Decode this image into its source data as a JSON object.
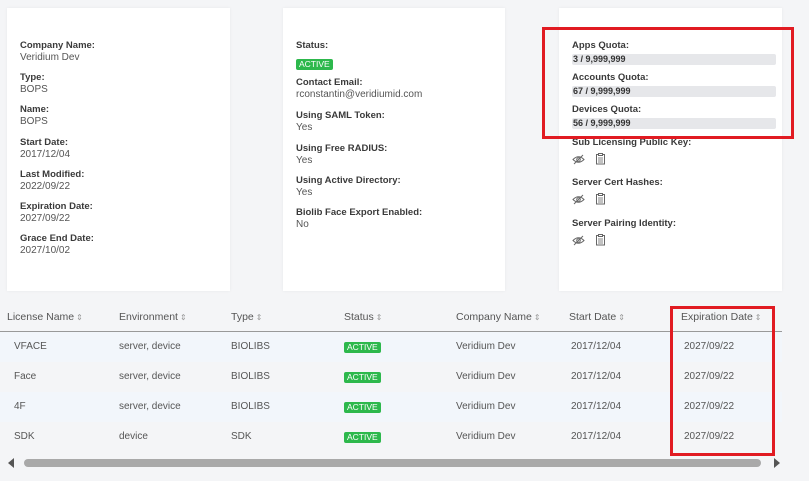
{
  "card1": {
    "fields": [
      {
        "label": "Company Name:",
        "value": "Veridium Dev"
      },
      {
        "label": "Type:",
        "value": "BOPS"
      },
      {
        "label": "Name:",
        "value": "BOPS"
      },
      {
        "label": "Start Date:",
        "value": "2017/12/04"
      },
      {
        "label": "Last Modified:",
        "value": "2022/09/22"
      },
      {
        "label": "Expiration Date:",
        "value": "2027/09/22"
      },
      {
        "label": "Grace End Date:",
        "value": "2027/10/02"
      }
    ]
  },
  "card2": {
    "status_label": "Status:",
    "status_value": "ACTIVE",
    "fields": [
      {
        "label": "Contact Email:",
        "value": "rconstantin@veridiumid.com"
      },
      {
        "label": "Using SAML Token:",
        "value": "Yes"
      },
      {
        "label": "Using Free RADIUS:",
        "value": "Yes"
      },
      {
        "label": "Using Active Directory:",
        "value": "Yes"
      },
      {
        "label": "Biolib Face Export Enabled:",
        "value": "No"
      }
    ]
  },
  "card3": {
    "quotas": [
      {
        "label": "Apps Quota:",
        "value": "3 / 9,999,999"
      },
      {
        "label": "Accounts Quota:",
        "value": "67 / 9,999,999"
      },
      {
        "label": "Devices Quota:",
        "value": "56 / 9,999,999"
      }
    ],
    "keys": [
      {
        "label": "Sub Licensing Public Key:"
      },
      {
        "label": "Server Cert Hashes:"
      },
      {
        "label": "Server Pairing Identity:"
      }
    ]
  },
  "table": {
    "columns": [
      "License Name",
      "Environment",
      "Type",
      "Status",
      "Company Name",
      "Start Date",
      "Expiration Date"
    ],
    "rows": [
      {
        "name": "VFACE",
        "environment": "server, device",
        "type": "BIOLIBS",
        "status": "ACTIVE",
        "company": "Veridium Dev",
        "start": "2017/12/04",
        "expiration": "2027/09/22"
      },
      {
        "name": "Face",
        "environment": "server, device",
        "type": "BIOLIBS",
        "status": "ACTIVE",
        "company": "Veridium Dev",
        "start": "2017/12/04",
        "expiration": "2027/09/22"
      },
      {
        "name": "4F",
        "environment": "server, device",
        "type": "BIOLIBS",
        "status": "ACTIVE",
        "company": "Veridium Dev",
        "start": "2017/12/04",
        "expiration": "2027/09/22"
      },
      {
        "name": "SDK",
        "environment": "device",
        "type": "SDK",
        "status": "ACTIVE",
        "company": "Veridium Dev",
        "start": "2017/12/04",
        "expiration": "2027/09/22"
      }
    ]
  },
  "colors": {
    "active_badge": "#2db84c",
    "highlight_box": "#e11b22",
    "alt_row": "#f2f6fb"
  },
  "icons": [
    "eye-slash-icon",
    "copy-icon"
  ]
}
